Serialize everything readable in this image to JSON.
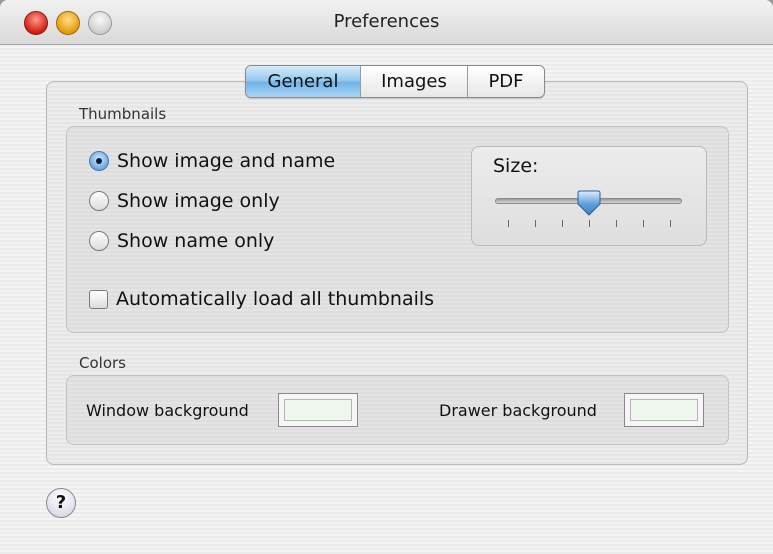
{
  "window": {
    "title": "Preferences"
  },
  "tabs": [
    {
      "label": "General",
      "active": true
    },
    {
      "label": "Images",
      "active": false
    },
    {
      "label": "PDF",
      "active": false
    }
  ],
  "thumbnails": {
    "group_label": "Thumbnails",
    "options": [
      {
        "label": "Show image and name",
        "selected": true
      },
      {
        "label": "Show image only",
        "selected": false
      },
      {
        "label": "Show name only",
        "selected": false
      }
    ],
    "auto_load": {
      "label": "Automatically load all thumbnails",
      "checked": false
    },
    "size": {
      "label": "Size:",
      "slider_position": 0.5,
      "tick_count": 7
    }
  },
  "colors": {
    "group_label": "Colors",
    "window_background": {
      "label": "Window background",
      "color": "#eef6ee"
    },
    "drawer_background": {
      "label": "Drawer background",
      "color": "#eef6ee"
    }
  },
  "help": {
    "label": "?"
  },
  "style": {
    "accent": "#6fb2e6"
  }
}
